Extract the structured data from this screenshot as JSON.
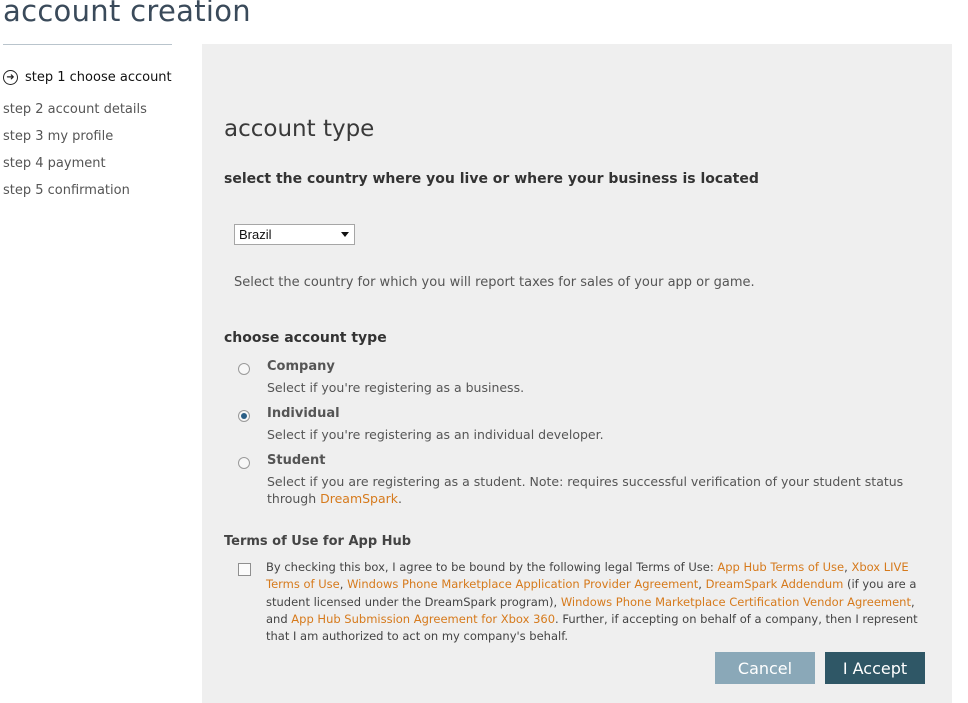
{
  "header": {
    "title": "account creation"
  },
  "steps": [
    {
      "label": "step 1 choose account",
      "current": true
    },
    {
      "label": "step 2 account details"
    },
    {
      "label": "step 3 my profile"
    },
    {
      "label": "step 4 payment"
    },
    {
      "label": "step 5 confirmation"
    }
  ],
  "form": {
    "section_title": "account type",
    "country_prompt": "select the country where you live or where your business is located",
    "country_selected": "Brazil",
    "country_help": "Select the country for which you will report taxes for sales of your app or game.",
    "account_type_prompt": "choose account type",
    "options": [
      {
        "title": "Company",
        "desc": "Select if you're registering as a business.",
        "checked": false
      },
      {
        "title": "Individual",
        "desc": "Select if you're registering as an individual developer.",
        "checked": true
      },
      {
        "title": "Student",
        "desc": "Select if you are registering as a student. Note: requires successful verification of your student status through",
        "link": "DreamSpark",
        "after": ".",
        "checked": false
      }
    ],
    "terms": {
      "title": "Terms of Use for App Hub",
      "checked": false,
      "t1": "By checking this box, I agree to be bound by the following legal Terms of Use: ",
      "l1": "App Hub Terms of Use",
      "t2": ", ",
      "l2": "Xbox LIVE Terms of Use",
      "t3": ", ",
      "l3": "Windows Phone Marketplace Application Provider Agreement",
      "t4": ", ",
      "l4": "DreamSpark Addendum",
      "t5": " (if you are a student licensed under the DreamSpark program), ",
      "l5": "Windows Phone Marketplace Certification Vendor Agreement",
      "t6": ", and ",
      "l6": "App Hub Submission Agreement for Xbox 360",
      "t7": ". Further, if accepting on behalf of a company, then I represent that I am authorized to act on my company's behalf."
    },
    "buttons": {
      "cancel": "Cancel",
      "accept": "I Accept"
    }
  },
  "colors": {
    "link": "#d67a1c",
    "accept_button": "#2f5766",
    "cancel_button": "#8aa8b8",
    "panel_bg": "#efefef"
  }
}
